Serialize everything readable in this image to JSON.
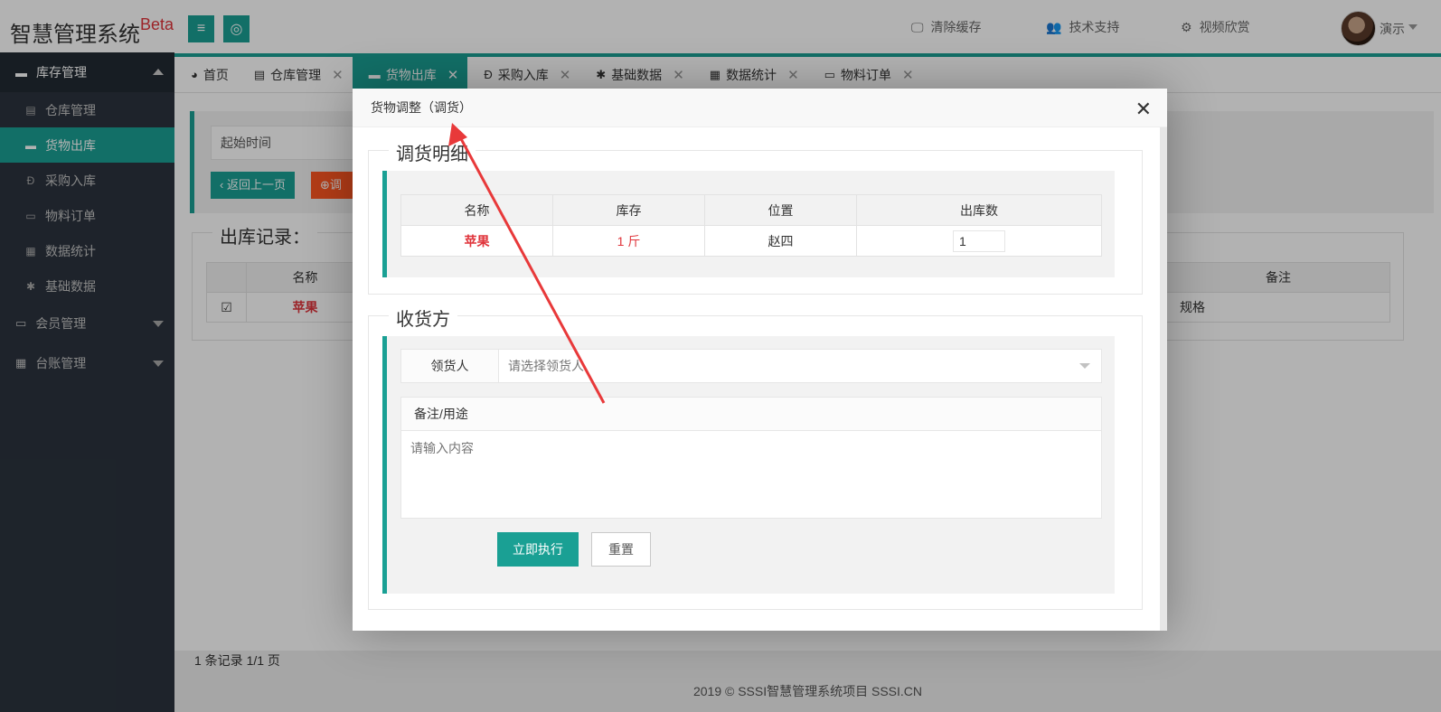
{
  "app": {
    "title": "智慧管理系统",
    "badge": "Beta"
  },
  "header": {
    "menu_icon": "hamburger-icon",
    "help_icon": "lifebuoy-icon",
    "links": [
      {
        "icon": "monitor-icon",
        "label": "清除缓存"
      },
      {
        "icon": "users-icon",
        "label": "技术支持"
      },
      {
        "icon": "gears-icon",
        "label": "视频欣赏"
      }
    ],
    "user": "演示"
  },
  "sidebar": {
    "section": "库存管理",
    "items": [
      {
        "label": "仓库管理",
        "icon": "document-icon"
      },
      {
        "label": "货物出库",
        "icon": "folder-icon",
        "active": true
      },
      {
        "label": "采购入库",
        "icon": "dollar-icon"
      },
      {
        "label": "物料订单",
        "icon": "laptop-icon"
      },
      {
        "label": "数据统计",
        "icon": "grid-icon"
      },
      {
        "label": "基础数据",
        "icon": "gear-icon"
      }
    ],
    "groups": [
      {
        "label": "会员管理",
        "icon": "card-icon"
      },
      {
        "label": "台账管理",
        "icon": "grid-icon"
      }
    ]
  },
  "tabs": [
    {
      "label": "首页",
      "icon": "dashboard-icon",
      "closable": false
    },
    {
      "label": "仓库管理",
      "icon": "document-icon",
      "closable": true
    },
    {
      "label": "货物出库",
      "icon": "folder-icon",
      "closable": true,
      "active": true
    },
    {
      "label": "采购入库",
      "icon": "dollar-icon",
      "closable": true
    },
    {
      "label": "基础数据",
      "icon": "gear-icon",
      "closable": true
    },
    {
      "label": "数据统计",
      "icon": "grid-icon",
      "closable": true
    },
    {
      "label": "物料订单",
      "icon": "laptop-icon",
      "closable": true
    }
  ],
  "main": {
    "start_time_placeholder": "起始时间",
    "back_button": "返回上一页",
    "adjust_button": "调",
    "records_title": "出库记录：",
    "columns": {
      "name": "名称",
      "remark": "备注"
    },
    "row": {
      "name": "苹果",
      "remark": "规格"
    },
    "pager": "1 条记录 1/1 页",
    "footer": "2019 ©  SSSI智慧管理系统项目  SSSI.CN"
  },
  "modal": {
    "title": "货物调整（调货）",
    "detail": {
      "legend": "调货明细",
      "headers": [
        "名称",
        "库存",
        "位置",
        "出库数"
      ],
      "row": {
        "name": "苹果",
        "stock": "1 斤",
        "location": "赵四",
        "qty": "1"
      }
    },
    "receiver": {
      "legend": "收货方",
      "label": "领货人",
      "placeholder": "请选择领货人",
      "remark_label": "备注/用途",
      "remark_placeholder": "请输入内容"
    },
    "submit": "立即执行",
    "reset": "重置"
  },
  "colors": {
    "accent": "#1aa094",
    "warning": "#ff5722",
    "danger": "#e0343b",
    "sidebar": "#2b333e",
    "annotation": "#e8393a"
  }
}
